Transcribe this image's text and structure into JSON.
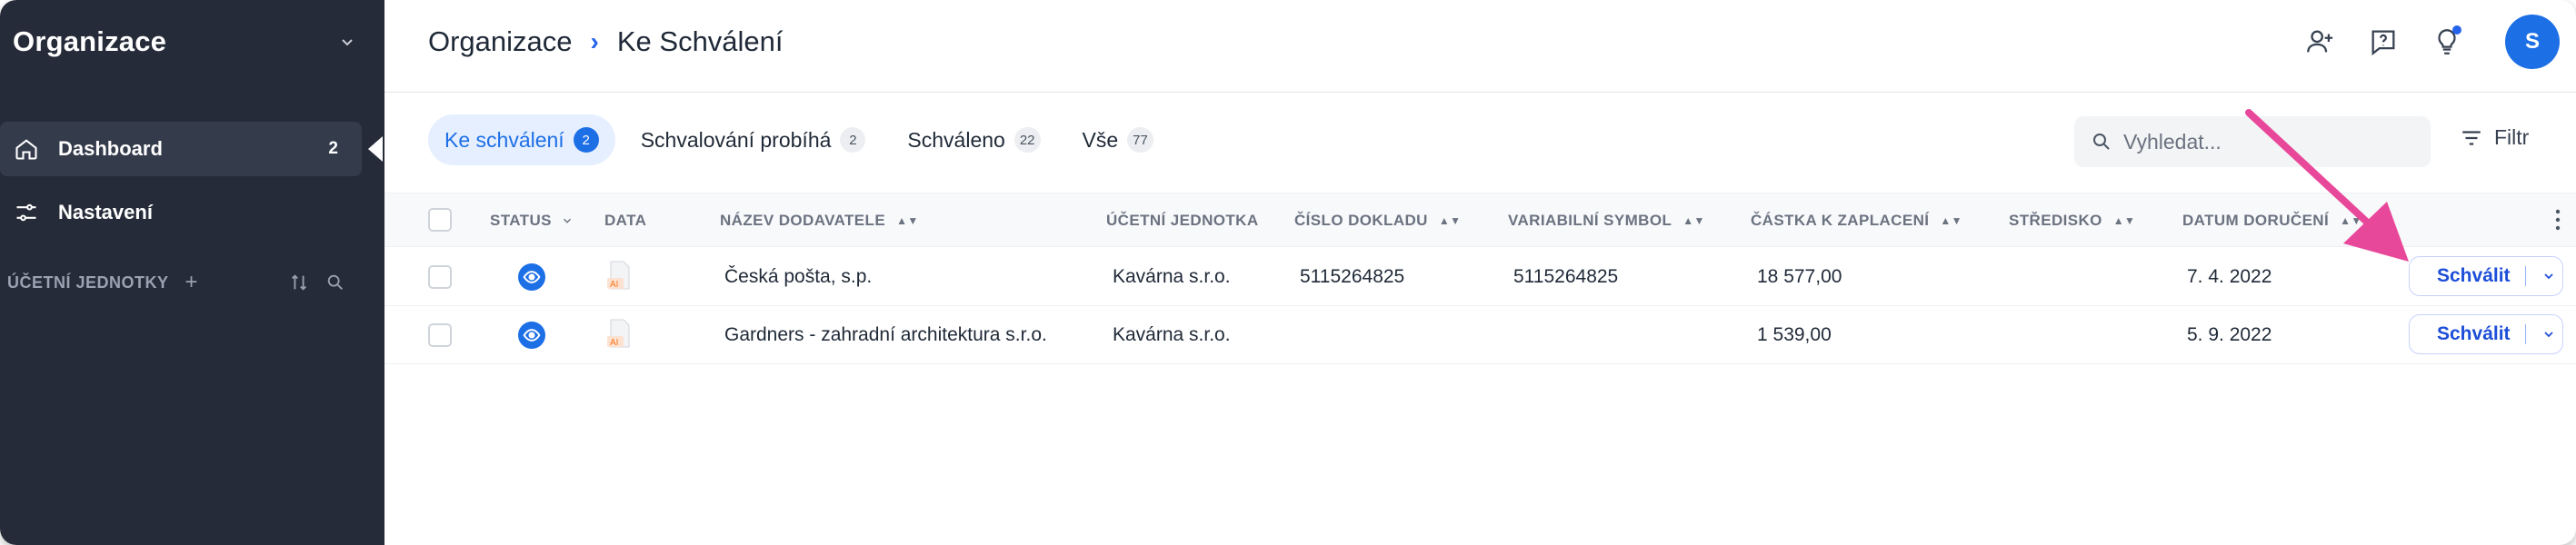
{
  "sidebar": {
    "org_title": "Organizace",
    "items": [
      {
        "label": "Dashboard",
        "count": "2",
        "icon": "home-icon"
      },
      {
        "label": "Nastavení",
        "count": "",
        "icon": "settings-sliders-icon"
      }
    ],
    "units_label": "ÚČETNÍ JEDNOTKY",
    "units_add": "+"
  },
  "header": {
    "breadcrumb": [
      "Organizace",
      "Ke Schválení"
    ],
    "breadcrumb_sep": "›",
    "avatar_initial": "S"
  },
  "tabs": [
    {
      "label": "Ke schválení",
      "count": "2",
      "active": true
    },
    {
      "label": "Schvalování probíhá",
      "count": "2",
      "active": false
    },
    {
      "label": "Schváleno",
      "count": "22",
      "active": false
    },
    {
      "label": "Vše",
      "count": "77",
      "active": false
    }
  ],
  "search": {
    "placeholder": "Vyhledat..."
  },
  "filter": {
    "label": "Filtr"
  },
  "table": {
    "columns": [
      "STATUS",
      "DATA",
      "NÁZEV DODAVATELE",
      "ÚČETNÍ JEDNOTKA",
      "ČÍSLO DOKLADU",
      "VARIABILNÍ SYMBOL",
      "ČÁSTKA K ZAPLACENÍ",
      "STŘEDISKO",
      "DATUM DORUČENÍ"
    ],
    "rows": [
      {
        "supplier": "Česká pošta, s.p.",
        "unit": "Kavárna s.r.o.",
        "doc_number": "5115264825",
        "var_symbol": "5115264825",
        "amount": "18 577,00",
        "center": "",
        "date": "7. 4. 2022",
        "file_tag": "AI"
      },
      {
        "supplier": "Gardners - zahradní architektura s.r.o.",
        "unit": "Kavárna s.r.o.",
        "doc_number": "",
        "var_symbol": "",
        "amount": "1 539,00",
        "center": "",
        "date": "5. 9. 2022",
        "file_tag": "AI"
      }
    ],
    "approve_label": "Schválit"
  },
  "colors": {
    "sidebar_bg": "#252b38",
    "accent": "#1d6fe6",
    "annotation_arrow": "#e8489a"
  }
}
